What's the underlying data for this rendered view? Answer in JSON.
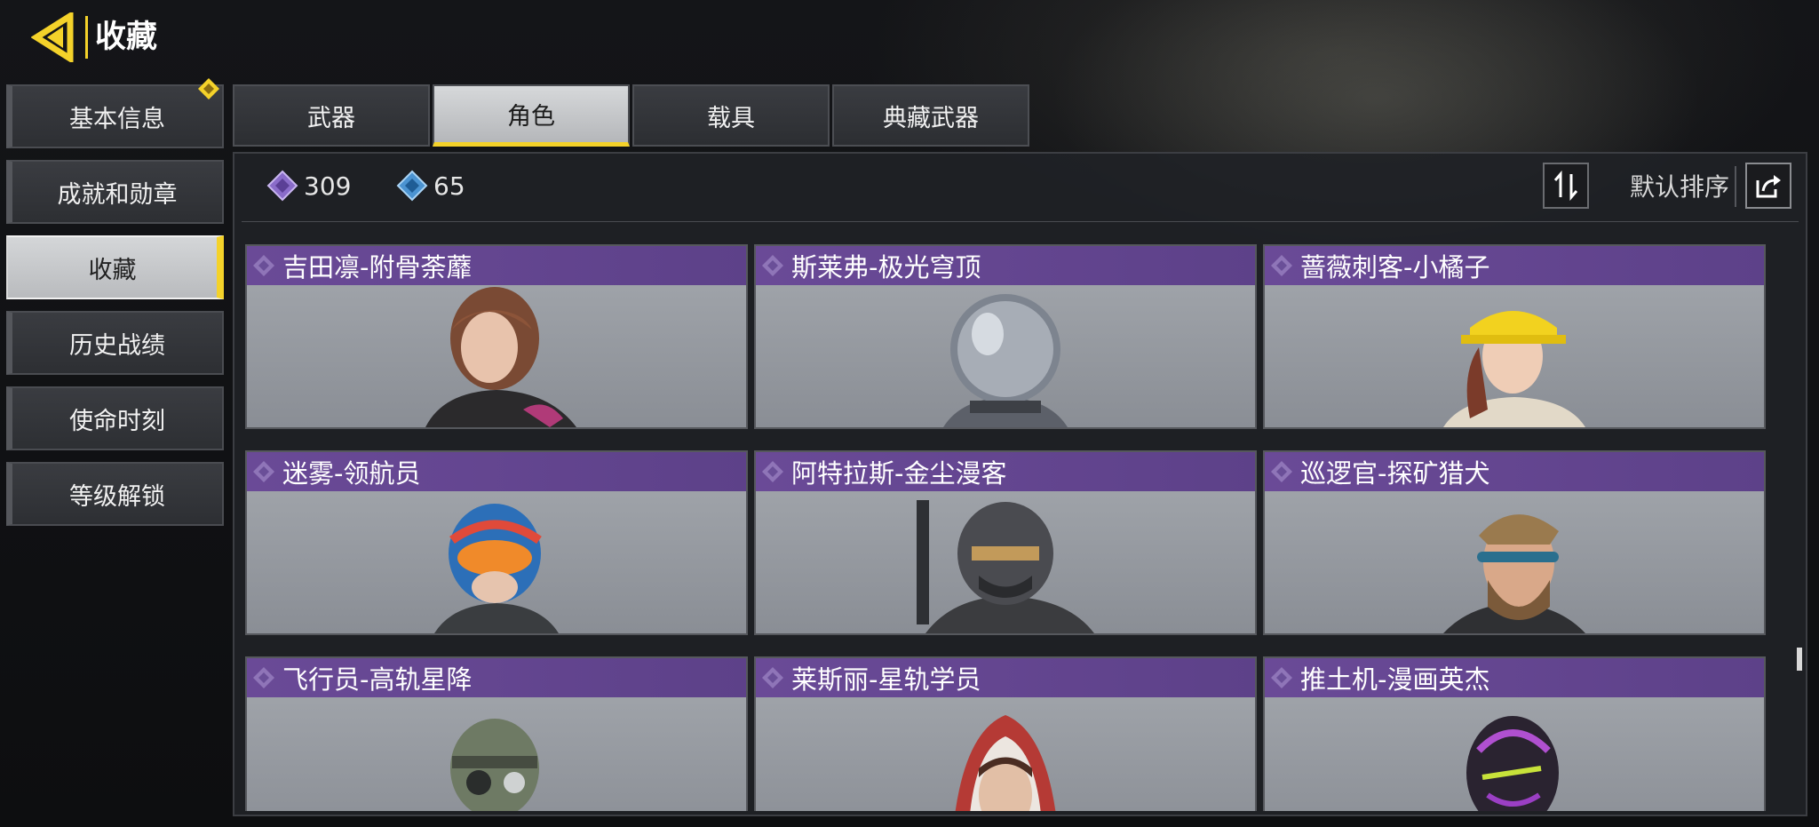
{
  "header": {
    "title": "收藏",
    "back_icon": "back-arrow-icon",
    "accent": "#f4d22a"
  },
  "sidebar": {
    "items": [
      {
        "label": "基本信息",
        "badge": true
      },
      {
        "label": "成就和勋章"
      },
      {
        "label": "收藏",
        "active": true
      },
      {
        "label": "历史战绩"
      },
      {
        "label": "使命时刻"
      },
      {
        "label": "等级解锁"
      }
    ]
  },
  "tabs": [
    {
      "label": "武器"
    },
    {
      "label": "角色",
      "active": true
    },
    {
      "label": "载具"
    },
    {
      "label": "典藏武器"
    }
  ],
  "toolbar": {
    "currency_purple": {
      "value": "309",
      "icon": "purple-diamond-icon",
      "color": "#9a7cd6"
    },
    "currency_blue": {
      "value": "65",
      "icon": "blue-diamond-icon",
      "color": "#5aa7e0"
    },
    "sort_label": "默认排序"
  },
  "cards": [
    {
      "name": "吉田凛-附骨荼蘼",
      "portrait": "woman-auburn-hair"
    },
    {
      "name": "斯莱弗-极光穹顶",
      "portrait": "astronaut-helmet"
    },
    {
      "name": "蔷薇刺客-小橘子",
      "portrait": "woman-yellow-cap"
    },
    {
      "name": "迷雾-领航员",
      "portrait": "pilot-blue-helmet"
    },
    {
      "name": "阿特拉斯-金尘漫客",
      "portrait": "armored-helmet-soldier"
    },
    {
      "name": "巡逻官-探矿猎犬",
      "portrait": "bearded-man-goggles"
    },
    {
      "name": "飞行员-高轨星降",
      "portrait": "soldier-gas-mask"
    },
    {
      "name": "莱斯丽-星轨学员",
      "portrait": "woman-red-hood"
    },
    {
      "name": "推土机-漫画英杰",
      "portrait": "purple-comic-helmet"
    }
  ],
  "colors": {
    "card_header": "#634592",
    "card_body": "#9a9ea5",
    "panel": "#202226"
  }
}
